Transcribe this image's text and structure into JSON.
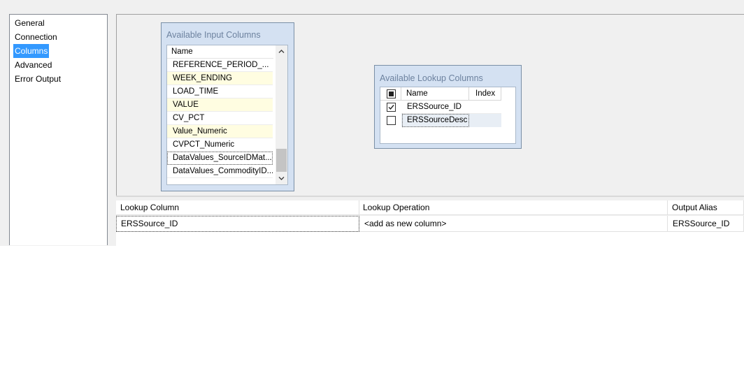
{
  "nav": {
    "items": [
      {
        "label": "General",
        "selected": false
      },
      {
        "label": "Connection",
        "selected": false
      },
      {
        "label": "Columns",
        "selected": true
      },
      {
        "label": "Advanced",
        "selected": false
      },
      {
        "label": "Error Output",
        "selected": false
      }
    ]
  },
  "input_columns": {
    "title": "Available Input Columns",
    "header": "Name",
    "rows": [
      {
        "label": "REFERENCE_PERIOD_...",
        "highlighted": false
      },
      {
        "label": "WEEK_ENDING",
        "highlighted": true
      },
      {
        "label": "LOAD_TIME",
        "highlighted": false
      },
      {
        "label": "VALUE",
        "highlighted": true
      },
      {
        "label": "CV_PCT",
        "highlighted": false
      },
      {
        "label": "Value_Numeric",
        "highlighted": true
      },
      {
        "label": "CVPCT_Numeric",
        "highlighted": false
      },
      {
        "label": "DataValues_SourceIDMat...",
        "highlighted": false
      },
      {
        "label": "DataValues_CommodityID...",
        "highlighted": false
      }
    ],
    "scroll_up_icon": "triangle-up-icon",
    "scroll_down_icon": "triangle-down-icon"
  },
  "lookup_columns": {
    "title": "Available Lookup Columns",
    "header_name": "Name",
    "header_index": "Index",
    "rows": [
      {
        "label": "ERSSource_ID",
        "checked": true
      },
      {
        "label": "ERSSourceDesc",
        "checked": false
      }
    ]
  },
  "mapping_grid": {
    "headers": [
      "Lookup Column",
      "Lookup Operation",
      "Output Alias"
    ],
    "rows": [
      [
        "ERSSource_ID",
        "<add as new column>",
        "ERSSource_ID"
      ]
    ]
  },
  "colors": {
    "selection": "#3399ff",
    "highlight_row": "#fffde1",
    "window_bg": "#d4e1f2"
  }
}
